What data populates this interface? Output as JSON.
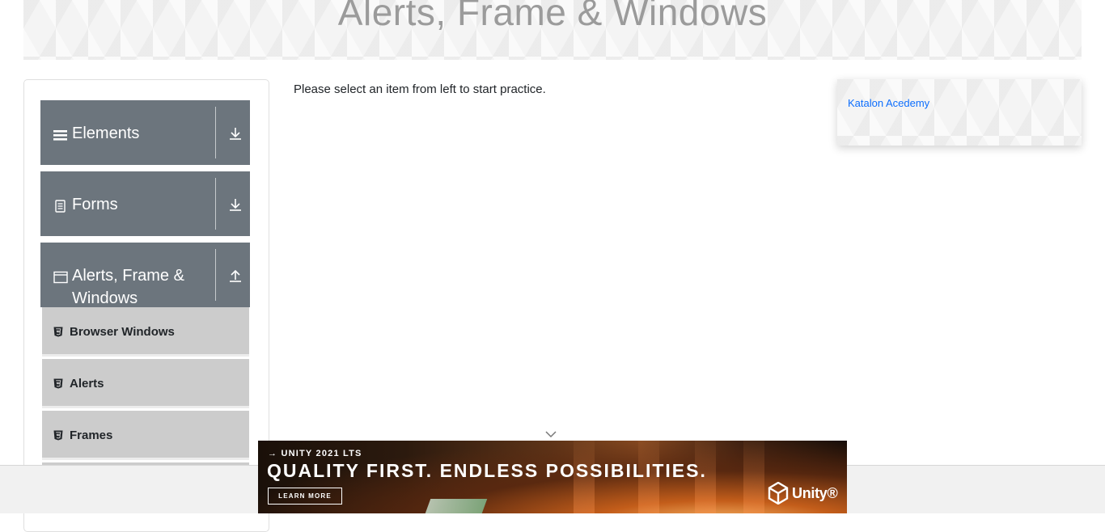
{
  "page": {
    "title": "Alerts, Frame & Windows",
    "instruction": "Please select an item from left to start practice."
  },
  "sidebar": {
    "groups": [
      {
        "label": "Elements",
        "icon": "hamburger-icon",
        "arrow": "download-arrow-icon"
      },
      {
        "label": "Forms",
        "icon": "document-icon",
        "arrow": "download-arrow-icon"
      },
      {
        "label": "Alerts, Frame & Windows",
        "icon": "window-icon",
        "arrow": "upload-arrow-icon"
      }
    ],
    "items": [
      {
        "label": "Browser Windows",
        "icon": "html5-icon"
      },
      {
        "label": "Alerts",
        "icon": "html5-icon"
      },
      {
        "label": "Frames",
        "icon": "html5-icon"
      }
    ]
  },
  "ad_card": {
    "link_text": "Katalon Acedemy"
  },
  "unity_ad": {
    "tag": "→ UNITY 2021 LTS",
    "headline": "QUALITY FIRST. ENDLESS POSSIBILITIES.",
    "cta": "LEARN MORE",
    "brand": "Unity®"
  },
  "colors": {
    "group_header_bg": "#6c757d",
    "menu_item_bg": "#cccccc",
    "link": "#0d6efd",
    "title_text": "#9b9b9b"
  }
}
